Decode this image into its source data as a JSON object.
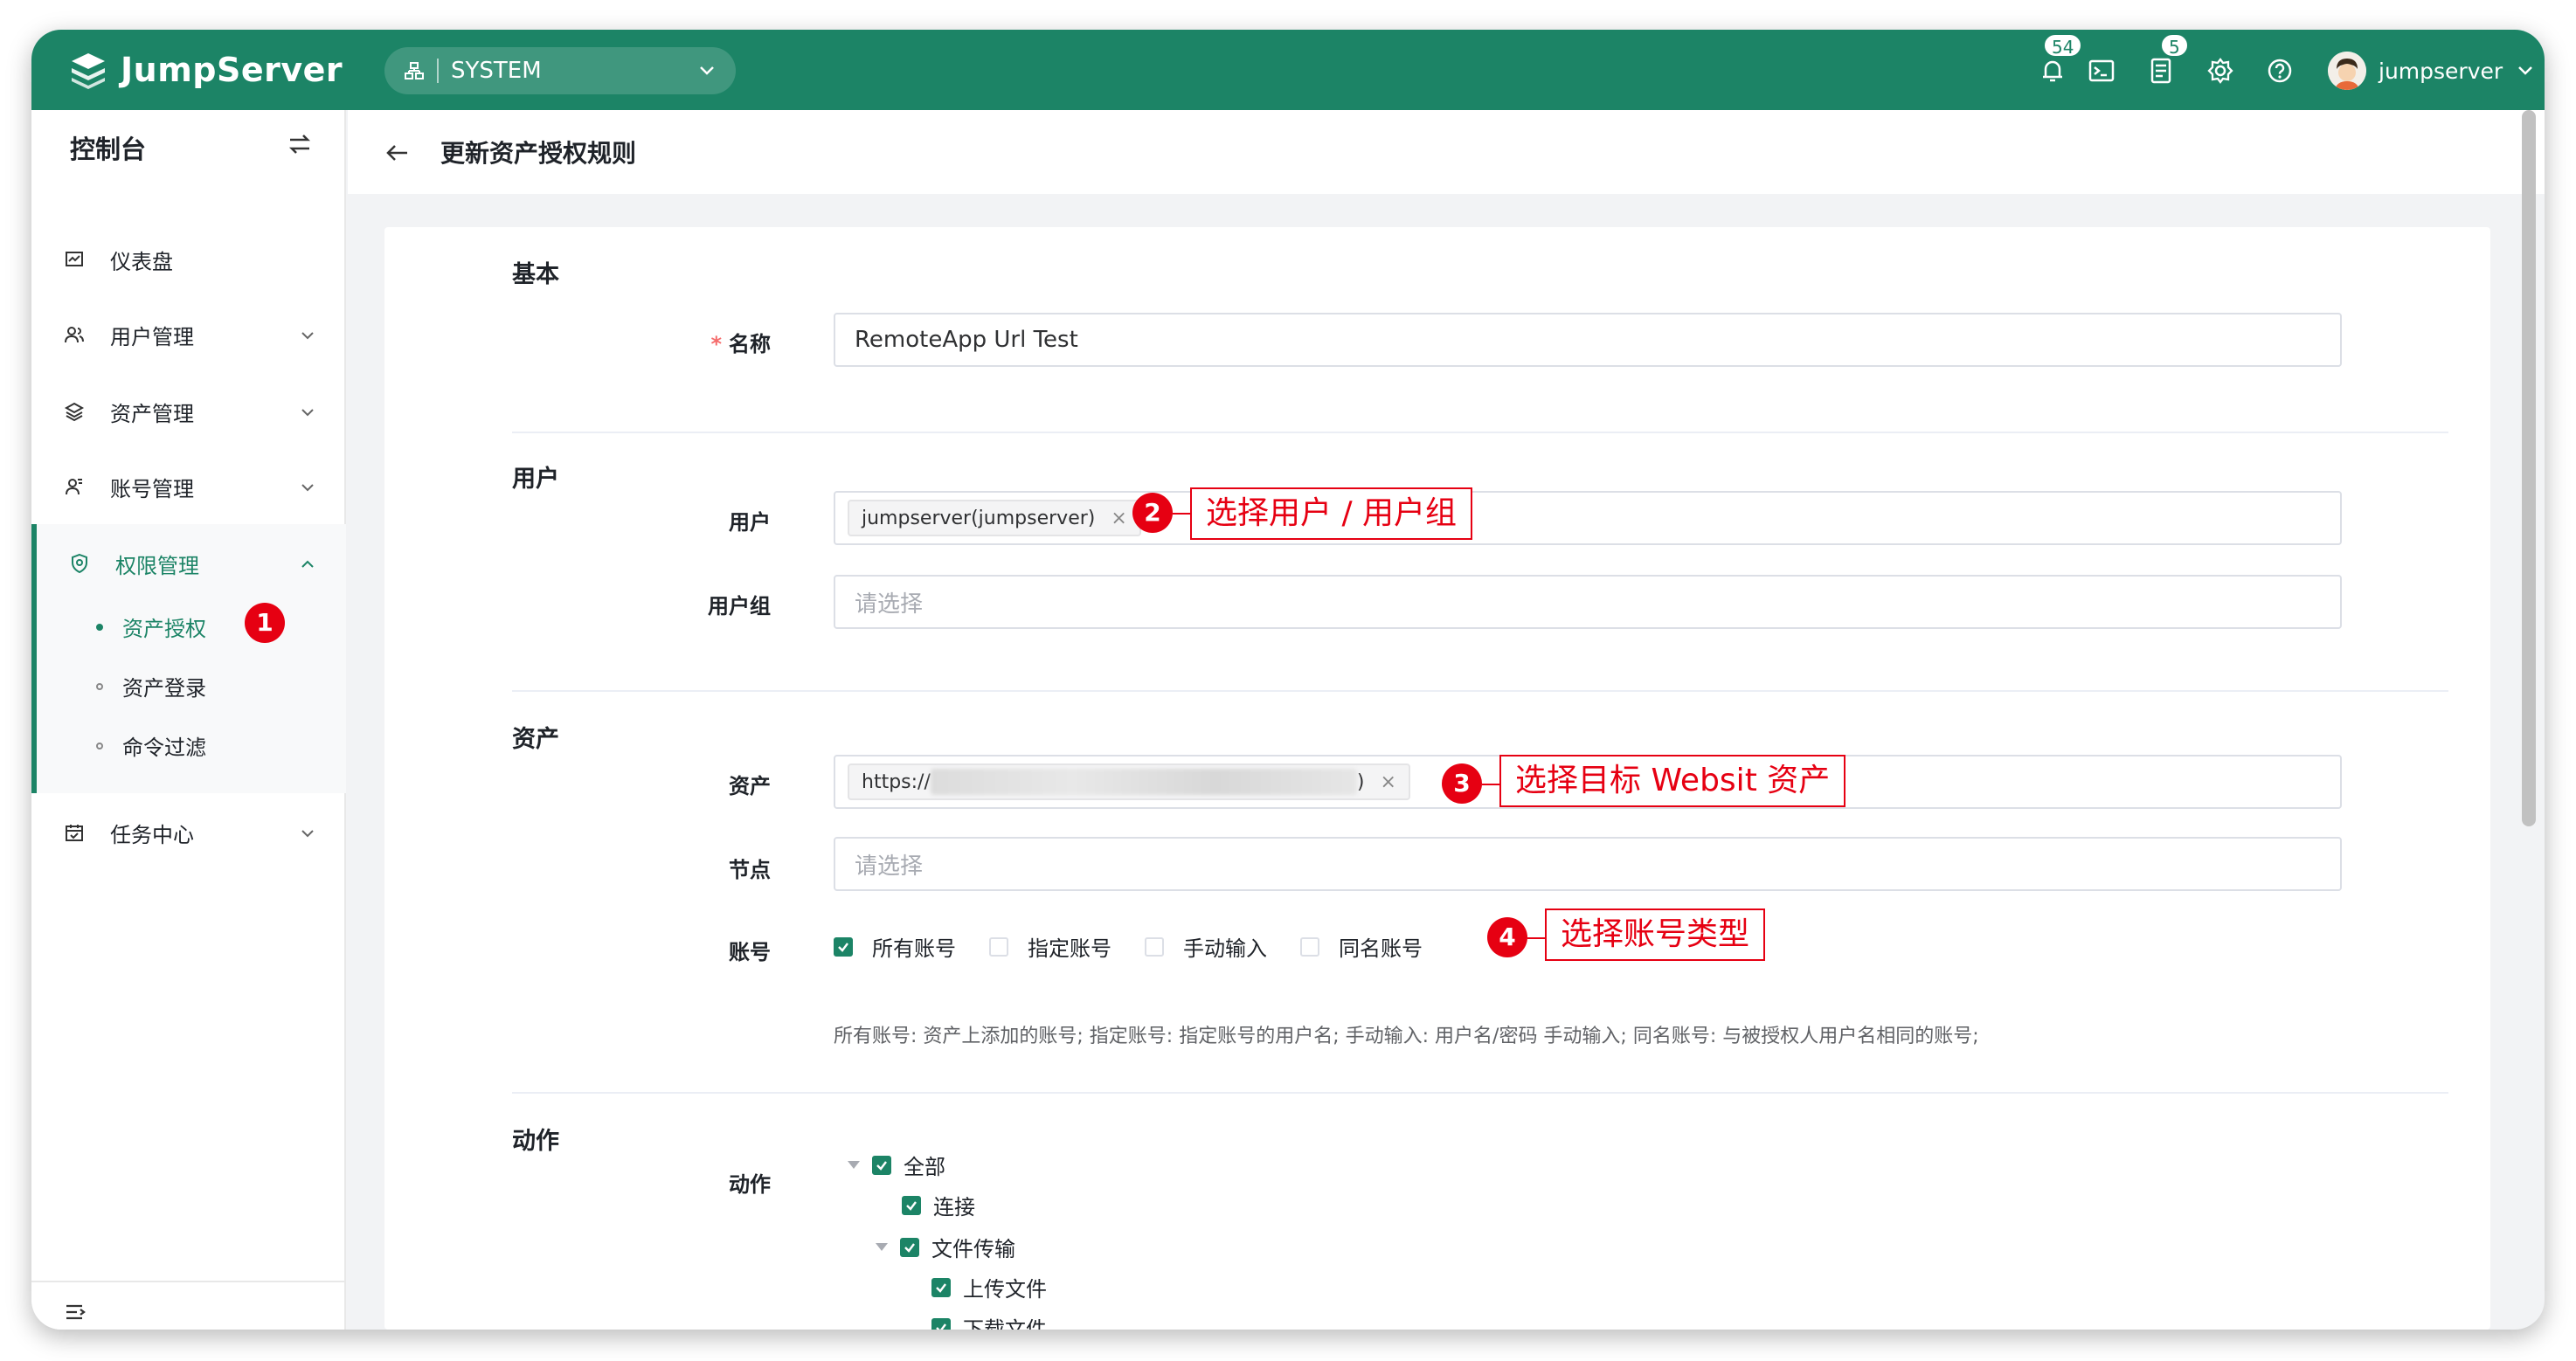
{
  "header": {
    "brand": "JumpServer",
    "org_select": "SYSTEM",
    "notifications_badge": "54",
    "tickets_badge": "5",
    "username": "jumpserver"
  },
  "sidebar": {
    "title": "控制台",
    "items": [
      {
        "label": "仪表盘"
      },
      {
        "label": "用户管理"
      },
      {
        "label": "资产管理"
      },
      {
        "label": "账号管理"
      },
      {
        "label": "权限管理"
      },
      {
        "label": "任务中心"
      }
    ],
    "subitems": [
      {
        "label": "资产授权"
      },
      {
        "label": "资产登录"
      },
      {
        "label": "命令过滤"
      }
    ]
  },
  "page": {
    "title": "更新资产授权规则"
  },
  "form": {
    "basic_section": "基本",
    "name_label": "名称",
    "name_value": "RemoteApp Url Test",
    "user_section": "用户",
    "user_label": "用户",
    "user_tag": "jumpserver(jumpserver)",
    "user_group_label": "用户组",
    "user_group_placeholder": "请选择",
    "asset_section": "资产",
    "asset_label": "资产",
    "asset_tag_prefix": "https://",
    "asset_tag_suffix": ")",
    "node_label": "节点",
    "node_placeholder": "请选择",
    "account_label": "账号",
    "account_options": [
      {
        "label": "所有账号",
        "checked": true
      },
      {
        "label": "指定账号",
        "checked": false
      },
      {
        "label": "手动输入",
        "checked": false
      },
      {
        "label": "同名账号",
        "checked": false
      }
    ],
    "account_hint": "所有账号: 资产上添加的账号; 指定账号:  指定账号的用户名;  手动输入: 用户名/密码 手动输入; 同名账号: 与被授权人用户名相同的账号;",
    "action_section": "动作",
    "action_label": "动作",
    "action_tree": [
      {
        "label": "全部"
      },
      {
        "label": "连接"
      },
      {
        "label": "文件传输"
      },
      {
        "label": "上传文件"
      },
      {
        "label": "下载文件"
      }
    ]
  },
  "annotations": [
    {
      "num": "1"
    },
    {
      "num": "2",
      "text": "选择用户 / 用户组"
    },
    {
      "num": "3",
      "text": "选择目标 Websit 资产"
    },
    {
      "num": "4",
      "text": "选择账号类型"
    }
  ],
  "colors": {
    "brand": "#1c8466",
    "annotation": "#e60012"
  }
}
